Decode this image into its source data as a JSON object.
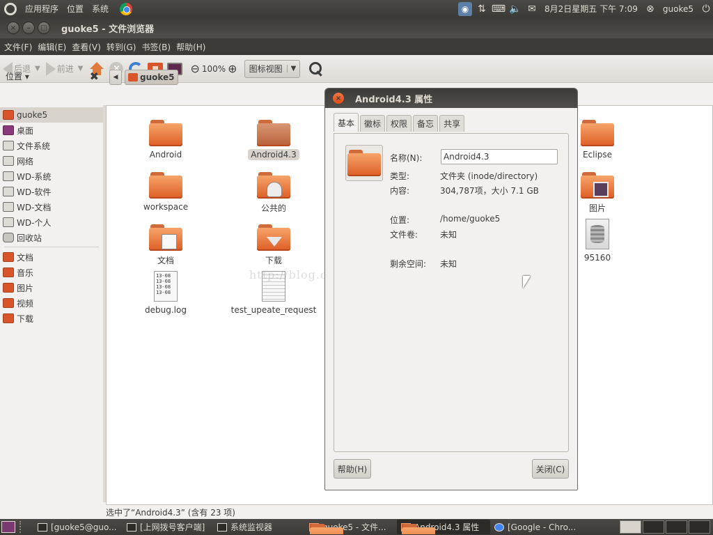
{
  "top_panel": {
    "menus": [
      "应用程序",
      "位置",
      "系统"
    ],
    "clock": "8月2日星期五 下午 7:09",
    "user": "guoke5"
  },
  "window": {
    "title": "guoke5 - 文件浏览器",
    "menubar": [
      "文件(F)",
      "编辑(E)",
      "查看(V)",
      "转到(G)",
      "书签(B)",
      "帮助(H)"
    ],
    "toolbar": {
      "back": "后退",
      "forward": "前进",
      "zoom": "100%",
      "view_mode": "图标视图"
    },
    "sidebar": {
      "header": "位置",
      "items": [
        {
          "label": "guoke5",
          "icon": "home-folder-icon"
        },
        {
          "label": "桌面",
          "icon": "desktop-icon"
        },
        {
          "label": "文件系统",
          "icon": "drive-icon"
        },
        {
          "label": "网络",
          "icon": "network-icon"
        },
        {
          "label": "WD-系统",
          "icon": "drive-icon"
        },
        {
          "label": "WD-软件",
          "icon": "drive-icon"
        },
        {
          "label": "WD-文档",
          "icon": "drive-icon"
        },
        {
          "label": "WD-个人",
          "icon": "drive-icon"
        },
        {
          "label": "回收站",
          "icon": "trash-icon"
        }
      ],
      "bookmarks": [
        {
          "label": "文档",
          "icon": "documents-icon"
        },
        {
          "label": "音乐",
          "icon": "music-icon"
        },
        {
          "label": "图片",
          "icon": "pictures-icon"
        },
        {
          "label": "视频",
          "icon": "videos-icon"
        },
        {
          "label": "下载",
          "icon": "downloads-icon"
        }
      ]
    },
    "path": {
      "crumb": "guoke5"
    },
    "files": [
      {
        "name": "Android",
        "kind": "folder"
      },
      {
        "name": "Android4.3",
        "kind": "folder"
      },
      {
        "name": "Eclipse",
        "kind": "folder"
      },
      {
        "name": "workspace",
        "kind": "folder"
      },
      {
        "name": "公共的",
        "kind": "folder-public"
      },
      {
        "name": "图片",
        "kind": "folder-pictures"
      },
      {
        "name": "文档",
        "kind": "folder-documents"
      },
      {
        "name": "下载",
        "kind": "folder-downloads"
      },
      {
        "name": "95160",
        "kind": "database"
      },
      {
        "name": "debug.log",
        "kind": "text",
        "preview": [
          "13-08",
          "13-08",
          "13-08",
          "13-08"
        ]
      },
      {
        "name": "test_upeate_request",
        "kind": "text"
      }
    ],
    "status": "选中了“Android4.3” (含有 23 项)",
    "watermark": "http://blog.csdn.net/luzhenrong45"
  },
  "dialog": {
    "title": "Android4.3 属性",
    "tabs": [
      "基本",
      "徽标",
      "权限",
      "备忘",
      "共享"
    ],
    "name_label": "名称(N):",
    "name_value": "Android4.3",
    "fields": [
      {
        "label": "类型:",
        "value": "文件夹 (inode/directory)"
      },
      {
        "label": "内容:",
        "value": "304,787项，大小 7.1 GB"
      },
      {
        "label": "位置:",
        "value": "/home/guoke5"
      },
      {
        "label": "文件卷:",
        "value": "未知"
      },
      {
        "label": "剩余空间:",
        "value": "未知"
      }
    ],
    "help_button": "帮助(H)",
    "close_button": "关闭(C)"
  },
  "taskbar": {
    "tasks": [
      {
        "label": "[guoke5@guo...",
        "icon": "terminal-icon"
      },
      {
        "label": "[上网拨号客户端]",
        "icon": "window-icon"
      },
      {
        "label": "系统监视器",
        "icon": "monitor-icon"
      },
      {
        "label": "guoke5 - 文件...",
        "icon": "folder-icon"
      },
      {
        "label": "Android4.3 属性",
        "icon": "folder-icon"
      },
      {
        "label": "[Google - Chro...",
        "icon": "chrome-icon"
      }
    ]
  }
}
